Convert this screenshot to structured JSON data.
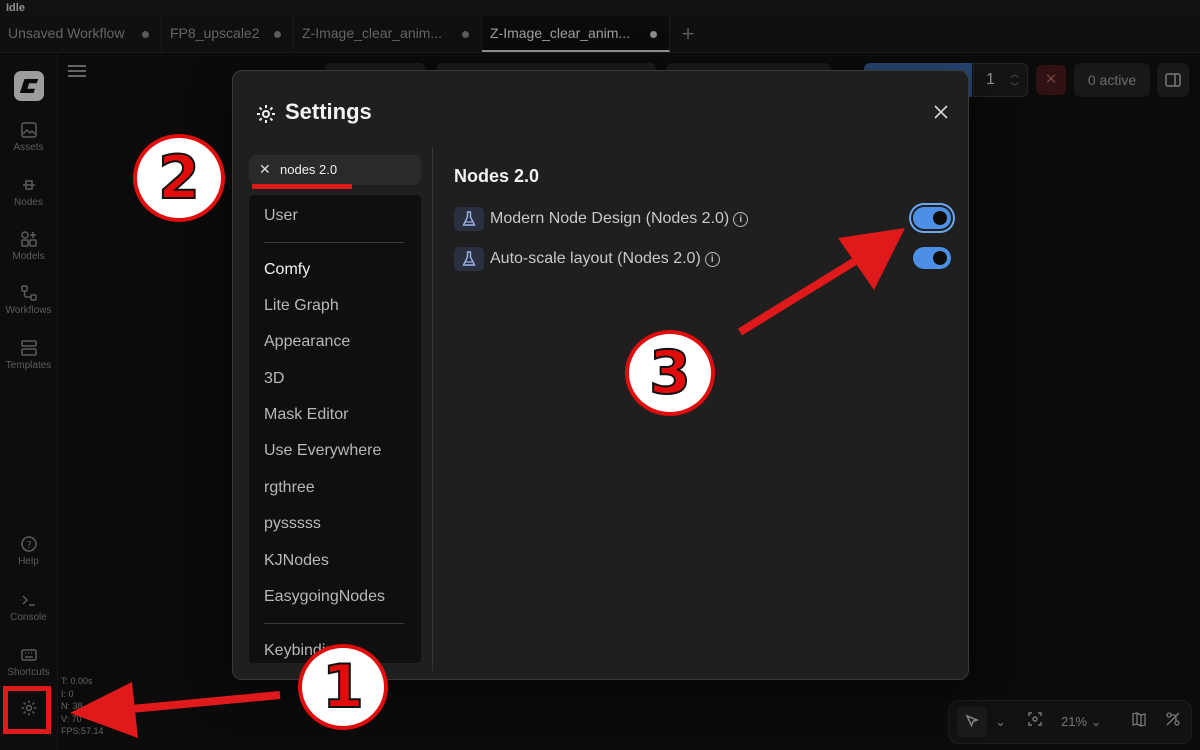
{
  "status_text": "Idle",
  "tabs": [
    {
      "label": "Unsaved Workflow",
      "active": false
    },
    {
      "label": "FP8_upscale2",
      "active": false
    },
    {
      "label": "Z-Image_clear_anim...",
      "active": false
    },
    {
      "label": "Z-Image_clear_anim...",
      "active": true
    }
  ],
  "sidebar": {
    "items": [
      {
        "label": "Assets",
        "icon": "image-icon"
      },
      {
        "label": "Nodes",
        "icon": "nodes-icon"
      },
      {
        "label": "Models",
        "icon": "models-icon"
      },
      {
        "label": "Workflows",
        "icon": "workflows-icon"
      },
      {
        "label": "Templates",
        "icon": "templates-icon"
      }
    ],
    "bottom_items": [
      {
        "label": "Help",
        "icon": "help-icon"
      },
      {
        "label": "Console",
        "icon": "terminal-icon"
      },
      {
        "label": "Shortcuts",
        "icon": "keyboard-icon"
      }
    ]
  },
  "stats": {
    "t": "T: 0.00s",
    "i": "I: 0",
    "n": "N: 38",
    "v": "V: 70",
    "fps": "FPS:57.14"
  },
  "toolbar": {
    "queue_count": "1",
    "active_label": "0 active"
  },
  "bottom_tools": {
    "zoom": "21%"
  },
  "settings": {
    "title": "Settings",
    "search_value": "nodes 2.0",
    "categories": [
      "User",
      "Comfy",
      "Lite Graph",
      "Appearance",
      "3D",
      "Mask Editor",
      "Use Everywhere",
      "rgthree",
      "pysssss",
      "KJNodes",
      "EasygoingNodes",
      "Keybinding"
    ],
    "section_title": "Nodes 2.0",
    "items": [
      {
        "label": "Modern Node Design (Nodes 2.0)",
        "enabled": true
      },
      {
        "label": "Auto-scale layout (Nodes 2.0)",
        "enabled": true
      }
    ]
  },
  "annotations": {
    "step1": "1",
    "step2": "2",
    "step3": "3"
  },
  "colors": {
    "accent_blue": "#4b8fe6",
    "annotation_red": "#e10d0d"
  }
}
